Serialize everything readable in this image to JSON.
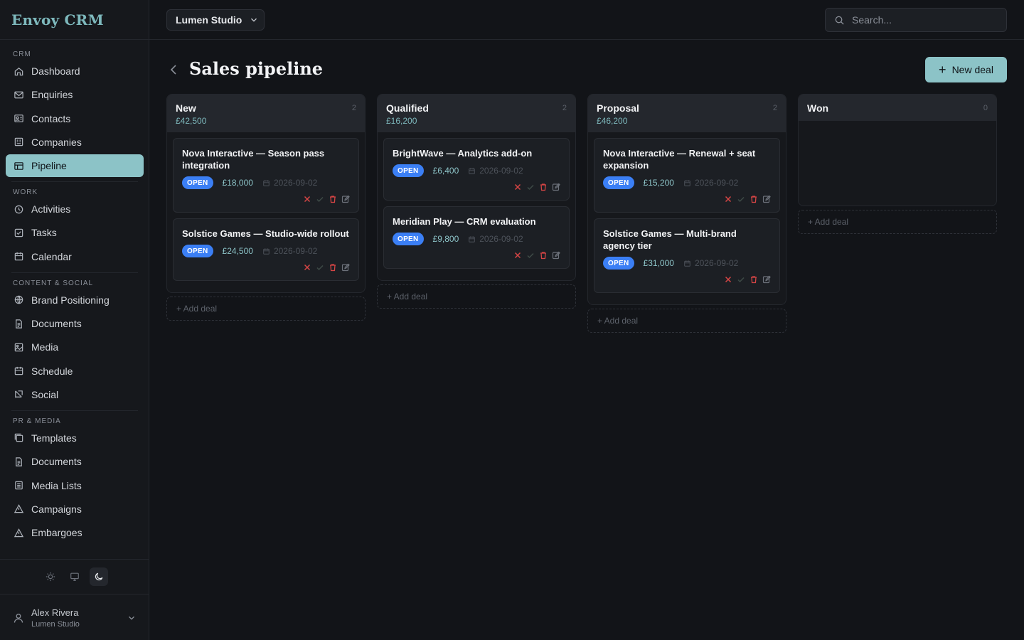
{
  "brand": {
    "name": "Envoy CRM"
  },
  "sidebar": {
    "sections": [
      {
        "label": "CRM",
        "items": [
          {
            "label": "Dashboard",
            "icon": "home-icon"
          },
          {
            "label": "Enquiries",
            "icon": "mail-icon"
          },
          {
            "label": "Contacts",
            "icon": "contacts-icon"
          },
          {
            "label": "Companies",
            "icon": "building-icon"
          },
          {
            "label": "Pipeline",
            "icon": "pipeline-icon",
            "active": true
          }
        ]
      },
      {
        "label": "WORK",
        "items": [
          {
            "label": "Activities",
            "icon": "clock-icon"
          },
          {
            "label": "Tasks",
            "icon": "task-icon"
          },
          {
            "label": "Calendar",
            "icon": "calendar-icon"
          }
        ]
      },
      {
        "label": "CONTENT & SOCIAL",
        "items": [
          {
            "label": "Brand Positioning",
            "icon": "globe-icon"
          },
          {
            "label": "Documents",
            "icon": "document-icon"
          },
          {
            "label": "Media",
            "icon": "image-icon"
          },
          {
            "label": "Schedule",
            "icon": "calendar-icon"
          },
          {
            "label": "Social",
            "icon": "social-icon"
          }
        ]
      },
      {
        "label": "PR & MEDIA",
        "items": [
          {
            "label": "Templates",
            "icon": "copy-icon"
          },
          {
            "label": "Documents",
            "icon": "document-icon"
          },
          {
            "label": "Media Lists",
            "icon": "list-icon"
          },
          {
            "label": "Campaigns",
            "icon": "triangle-icon"
          },
          {
            "label": "Embargoes",
            "icon": "warning-icon"
          }
        ]
      }
    ]
  },
  "theme": {
    "options": [
      "light",
      "system",
      "dark"
    ],
    "selected": "dark"
  },
  "user": {
    "name": "Alex Rivera",
    "org": "Lumen Studio"
  },
  "topbar": {
    "org_select": "Lumen Studio",
    "search_placeholder": "Search..."
  },
  "page": {
    "title": "Sales pipeline",
    "new_deal_label": "New deal",
    "add_deal_label": "+ Add deal"
  },
  "colors": {
    "accent": "#8cc3c7",
    "badge": "#3b7ff5",
    "danger": "#d64545"
  },
  "columns": [
    {
      "name": "New",
      "total": "£42,500",
      "count": "2",
      "deals": [
        {
          "title": "Nova Interactive — Season pass integration",
          "status": "OPEN",
          "amount": "£18,000",
          "date": "2026-09-02"
        },
        {
          "title": "Solstice Games — Studio-wide rollout",
          "status": "OPEN",
          "amount": "£24,500",
          "date": "2026-09-02"
        }
      ]
    },
    {
      "name": "Qualified",
      "total": "£16,200",
      "count": "2",
      "deals": [
        {
          "title": "BrightWave — Analytics add-on",
          "status": "OPEN",
          "amount": "£6,400",
          "date": "2026-09-02"
        },
        {
          "title": "Meridian Play — CRM evaluation",
          "status": "OPEN",
          "amount": "£9,800",
          "date": "2026-09-02"
        }
      ]
    },
    {
      "name": "Proposal",
      "total": "£46,200",
      "count": "2",
      "deals": [
        {
          "title": "Nova Interactive — Renewal + seat expansion",
          "status": "OPEN",
          "amount": "£15,200",
          "date": "2026-09-02"
        },
        {
          "title": "Solstice Games — Multi-brand agency tier",
          "status": "OPEN",
          "amount": "£31,000",
          "date": "2026-09-02"
        }
      ]
    },
    {
      "name": "Won",
      "total": "",
      "count": "0",
      "deals": []
    }
  ]
}
